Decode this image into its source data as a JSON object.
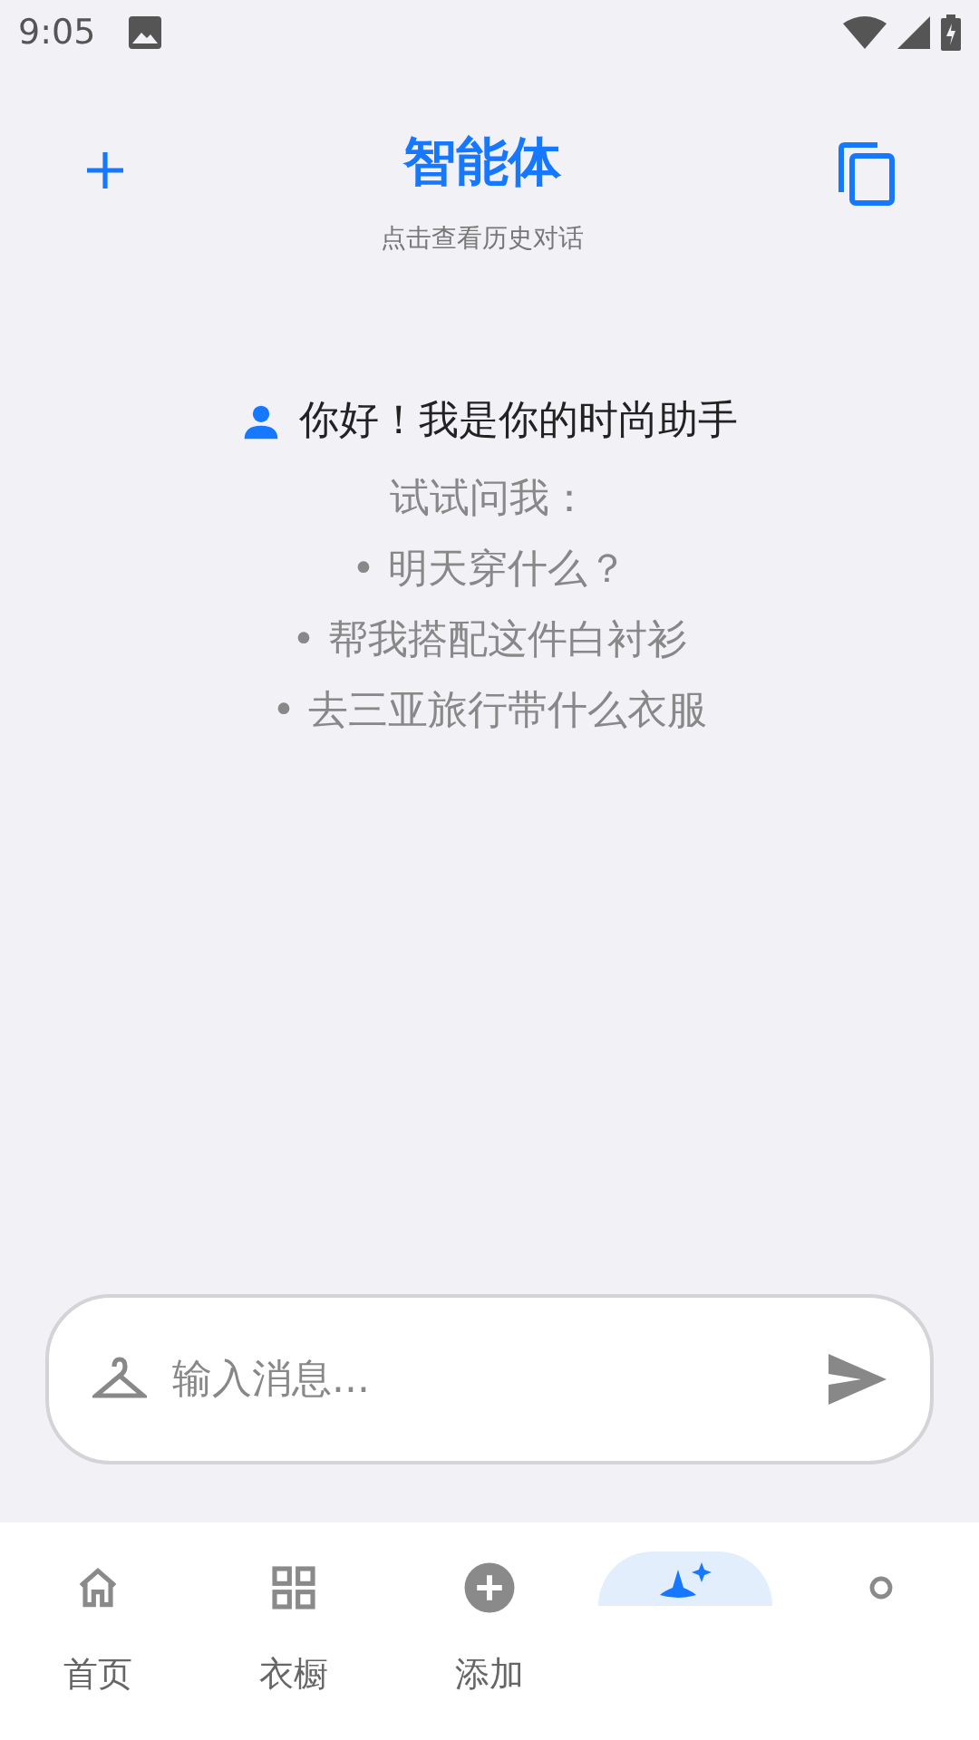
{
  "status_bar": {
    "time": "9:05"
  },
  "header": {
    "title": "智能体",
    "subtitle": "点击查看历史对话"
  },
  "welcome": {
    "greeting": "你好！我是你的时尚助手",
    "prompt": "试试问我：",
    "suggestions": [
      "• 明天穿什么？",
      "• 帮我搭配这件白衬衫",
      "• 去三亚旅行带什么衣服"
    ]
  },
  "composer": {
    "placeholder": "输入消息..."
  },
  "bottom_nav": [
    {
      "kind": "home",
      "label": "首页",
      "selected": false
    },
    {
      "kind": "grid",
      "label": "衣橱",
      "selected": false
    },
    {
      "kind": "add",
      "label": "添加",
      "selected": false
    },
    {
      "kind": "sparkle",
      "selected": true
    },
    {
      "kind": "dot",
      "selected": false
    }
  ]
}
